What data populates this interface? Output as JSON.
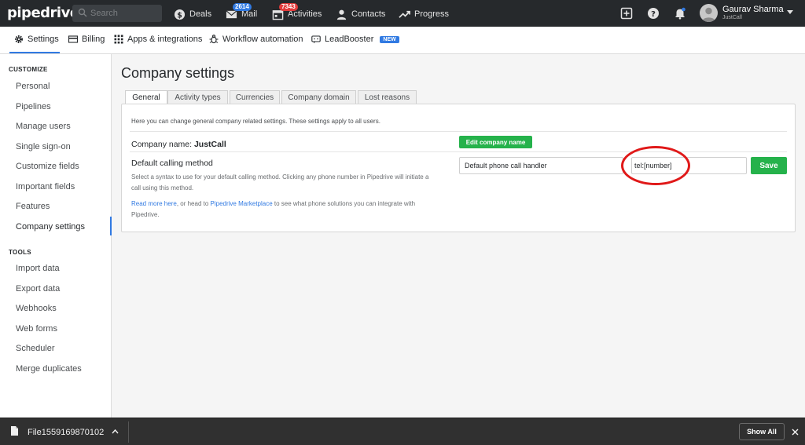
{
  "topbar": {
    "logo": "pipedrive",
    "search_placeholder": "Search",
    "nav": [
      {
        "label": "Deals",
        "icon": "dollar-icon"
      },
      {
        "label": "Mail",
        "icon": "mail-icon",
        "badge": "2614"
      },
      {
        "label": "Activities",
        "icon": "calendar-icon",
        "badge": "7343"
      },
      {
        "label": "Contacts",
        "icon": "person-icon"
      },
      {
        "label": "Progress",
        "icon": "trend-icon"
      }
    ],
    "user_name": "Gaurav Sharma",
    "user_company": "JustCall"
  },
  "subnav": {
    "items": [
      {
        "label": "Settings",
        "icon": "gear-icon"
      },
      {
        "label": "Billing",
        "icon": "card-icon"
      },
      {
        "label": "Apps & integrations",
        "icon": "grid-icon"
      },
      {
        "label": "Workflow automation",
        "icon": "bug-icon"
      },
      {
        "label": "LeadBooster",
        "icon": "chat-icon",
        "tag": "NEW"
      }
    ]
  },
  "sidebar": {
    "customize_heading": "CUSTOMIZE",
    "customize_items": [
      "Personal",
      "Pipelines",
      "Manage users",
      "Single sign-on",
      "Customize fields",
      "Important fields",
      "Features",
      "Company settings"
    ],
    "tools_heading": "TOOLS",
    "tools_items": [
      "Import data",
      "Export data",
      "Webhooks",
      "Web forms",
      "Scheduler",
      "Merge duplicates"
    ]
  },
  "main": {
    "title": "Company settings",
    "tabs": [
      "General",
      "Activity types",
      "Currencies",
      "Company domain",
      "Lost reasons"
    ],
    "intro": "Here you can change general company related settings. These settings apply to all users.",
    "company_name_label": "Company name:",
    "company_name_value": "JustCall",
    "edit_button": "Edit company name",
    "calling_label": "Default calling method",
    "calling_desc": "Select a syntax to use for your default calling method. Clicking any phone number in Pipedrive will initiate a call using this method.",
    "read_more_link": "Read more here",
    "more_text_1": ", or head to ",
    "marketplace_link": "Pipedrive Marketplace",
    "more_text_2": " to see what phone solutions you can integrate with Pipedrive.",
    "handler_value": "Default phone call handler",
    "tel_value": "tel:[number]",
    "save_button": "Save"
  },
  "downloads": {
    "file_name": "File1559169870102",
    "show_all": "Show All"
  },
  "colors": {
    "accent": "#317ae2",
    "green": "#25b24b",
    "highlight": "#e01919",
    "topbar": "#26292c"
  }
}
